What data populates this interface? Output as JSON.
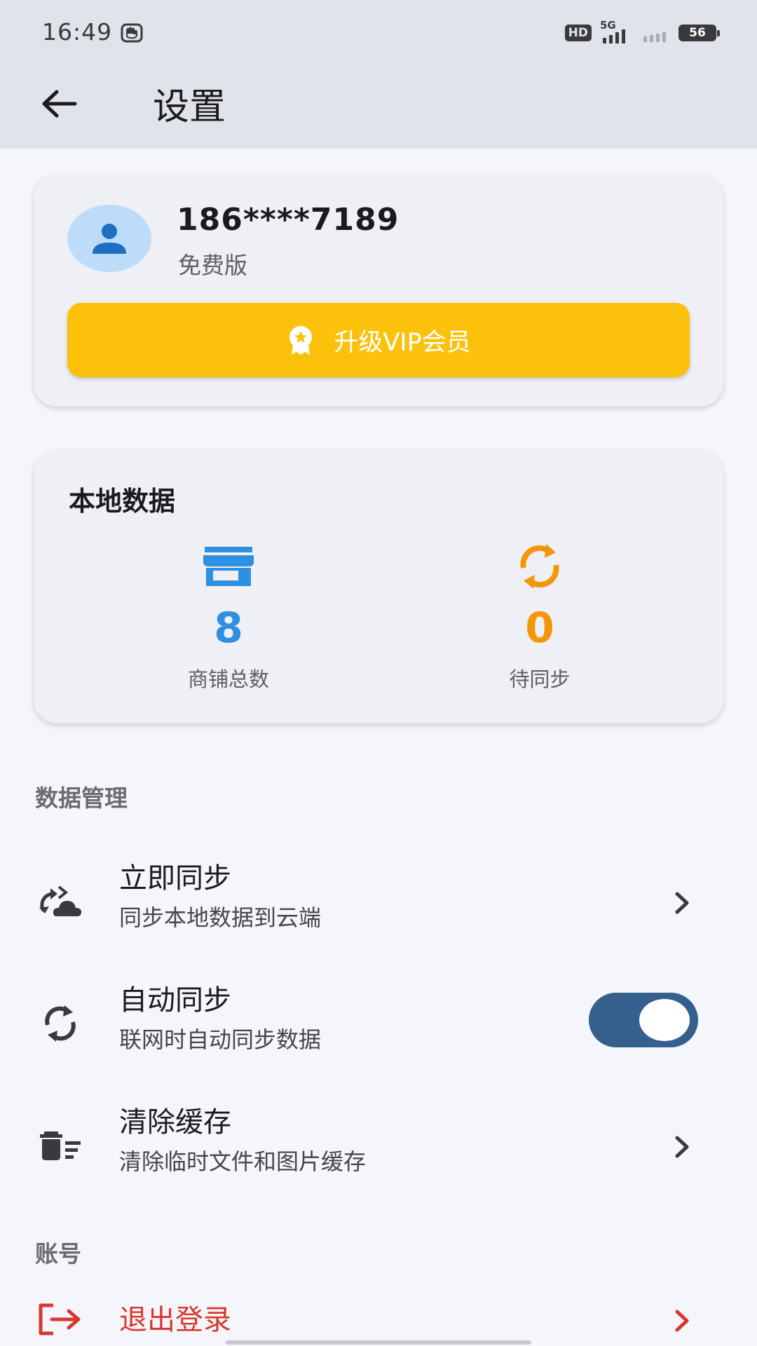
{
  "status_bar": {
    "time": "16:49",
    "hd_label": "HD",
    "network_label": "5G",
    "battery": "56"
  },
  "app_bar": {
    "title": "设置",
    "back_icon": "arrow-back-icon"
  },
  "profile": {
    "phone": "186****7189",
    "plan": "免费版",
    "vip_button_label": "升级VIP会员",
    "avatar_icon": "person-icon",
    "vip_icon": "award-icon"
  },
  "local_data": {
    "title": "本地数据",
    "stats": [
      {
        "value": "8",
        "label": "商铺总数",
        "icon": "store-icon",
        "color": "#2f8fe0"
      },
      {
        "value": "0",
        "label": "待同步",
        "icon": "sync-icon",
        "color": "#f3960a"
      }
    ]
  },
  "data_management": {
    "header": "数据管理",
    "items": [
      {
        "title": "立即同步",
        "subtitle": "同步本地数据到云端",
        "icon": "cloud-sync-icon"
      },
      {
        "title": "自动同步",
        "subtitle": "联网时自动同步数据",
        "icon": "sync-icon",
        "toggle_on": true
      },
      {
        "title": "清除缓存",
        "subtitle": "清除临时文件和图片缓存",
        "icon": "delete-sweep-icon"
      }
    ]
  },
  "account": {
    "header": "账号",
    "logout_label": "退出登录",
    "logout_icon": "logout-icon"
  },
  "colors": {
    "accent_yellow": "#fcc10a",
    "blue": "#2f8fe0",
    "orange": "#f3960a",
    "toggle_on": "#355f8d",
    "danger": "#d8382f"
  }
}
